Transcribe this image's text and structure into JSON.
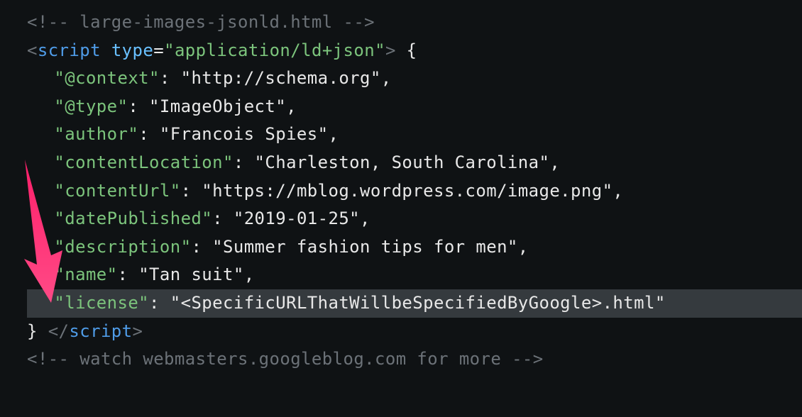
{
  "code": {
    "comment_top": "<!-- large-images-jsonld.html -->",
    "scriptOpen": {
      "angOpen": "<",
      "tag": "script",
      "attrName": "type",
      "eq": "=",
      "attrValue": "\"application/ld+json\"",
      "angClose": ">",
      "after": " {"
    },
    "l_context_k": "\"@context\"",
    "l_context_v": "\"http://schema.org\"",
    "l_type_k": "\"@type\"",
    "l_type_v": "\"ImageObject\"",
    "l_author_k": "\"author\"",
    "l_author_v": "\"Francois Spies\"",
    "l_loc_k": "\"contentLocation\"",
    "l_loc_v": "\"Charleston, South Carolina\"",
    "l_url_k": "\"contentUrl\"",
    "l_url_v": "\"https://mblog.wordpress.com/image.png\"",
    "l_date_k": "\"datePublished\"",
    "l_date_v": "\"2019-01-25\"",
    "l_desc_k": "\"description\"",
    "l_desc_v": "\"Summer fashion tips for men\"",
    "l_name_k": "\"name\"",
    "l_name_v": "\"Tan suit\"",
    "l_lic_k": "\"license\"",
    "l_lic_v": "\"<SpecificURLThatWillbeSpecifiedByGoogle>.html\"",
    "colon": ": ",
    "comma": ",",
    "braceClose": "} ",
    "scriptClose": {
      "angOpen": "</",
      "tag": "script",
      "angClose": ">"
    },
    "comment_bottom": "<!-- watch webmasters.googleblog.com for more -->"
  },
  "annotation": {
    "arrow": "pointer-arrow"
  }
}
